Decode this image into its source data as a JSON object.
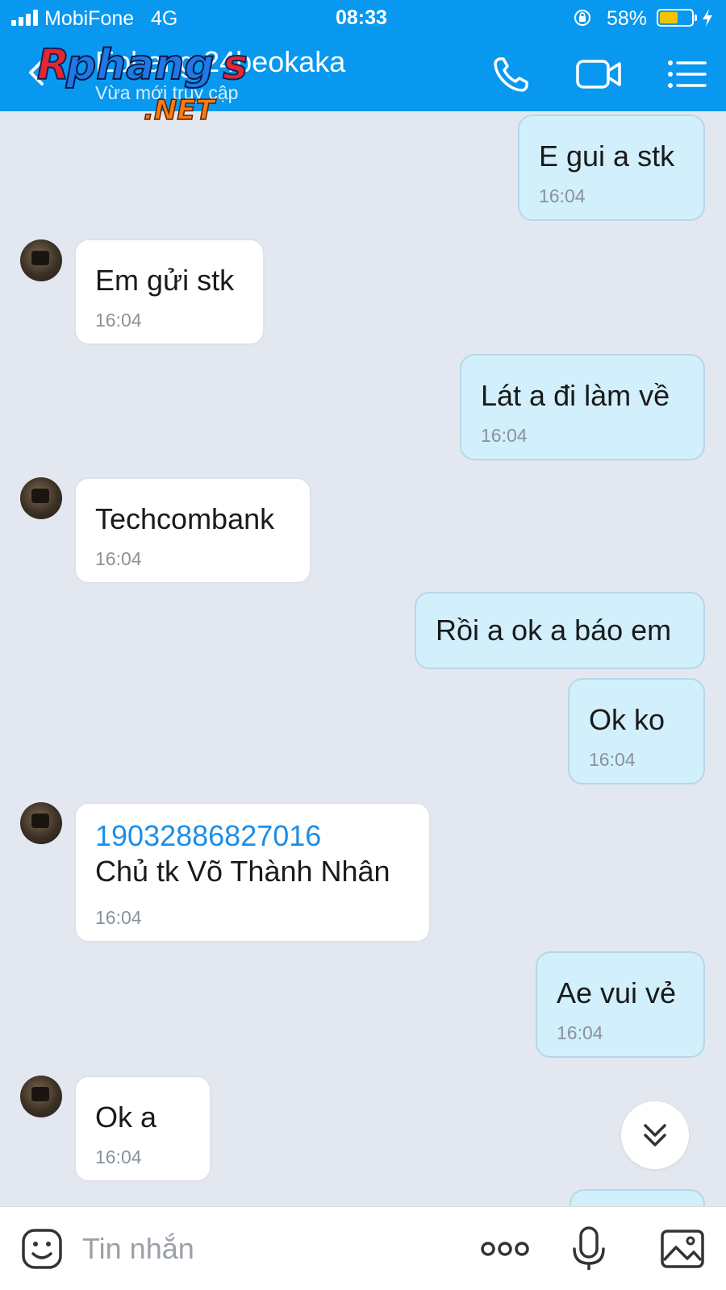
{
  "status": {
    "carrier": "MobiFone",
    "network": "4G",
    "time": "08:33",
    "battery_percent": "58%",
    "battery_level": 0.58
  },
  "header": {
    "title": "Ephang 24beokaka",
    "subtitle": "Vừa mới truy cập",
    "watermark": "Rphangs.NET",
    "icons": [
      "back-icon",
      "phone-icon",
      "video-icon",
      "menu-list-icon"
    ]
  },
  "messages": [
    {
      "from": "me",
      "text": "E gui a stk",
      "time": "16:04"
    },
    {
      "from": "them",
      "text": "Em gửi stk",
      "time": "16:04"
    },
    {
      "from": "me",
      "text": "Lát a đi làm về",
      "time": "16:04"
    },
    {
      "from": "them",
      "text": "Techcombank",
      "time": "16:04"
    },
    {
      "from": "me",
      "text": "Rồi a ok a báo em",
      "time": ""
    },
    {
      "from": "me",
      "text": "Ok ko",
      "time": "16:04"
    },
    {
      "from": "them",
      "link": "19032886827016",
      "text": "Chủ tk Võ Thành Nhân",
      "time": "16:04"
    },
    {
      "from": "me",
      "text": "Ae vui vẻ",
      "time": "16:04"
    },
    {
      "from": "them",
      "text": "Ok a",
      "time": "16:04"
    }
  ],
  "composer": {
    "placeholder": "Tin nhắn",
    "icons": [
      "sticker-icon",
      "more-dots-icon",
      "microphone-icon",
      "image-icon"
    ]
  },
  "colors": {
    "header": "#0898ef",
    "background": "#e3e8f0",
    "my_bubble": "#d2effc",
    "their_bubble": "#ffffff",
    "link": "#1d8ee6",
    "battery_fill": "#f4c300"
  }
}
